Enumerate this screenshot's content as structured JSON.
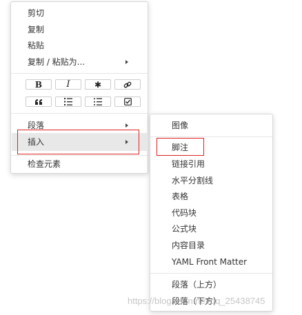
{
  "main_menu": {
    "cut": "剪切",
    "copy": "复制",
    "paste": "粘贴",
    "copy_paste_as": "复制 / 粘贴为...",
    "paragraph": "段落",
    "insert": "插入",
    "inspect": "检查元素",
    "format_buttons": [
      {
        "icon": "bold-icon",
        "glyph": "B"
      },
      {
        "icon": "italic-icon",
        "glyph": "I"
      },
      {
        "icon": "code-icon",
        "glyph": "✱"
      },
      {
        "icon": "link-icon"
      },
      {
        "icon": "quote-icon"
      },
      {
        "icon": "ordered-list-icon"
      },
      {
        "icon": "unordered-list-icon"
      },
      {
        "icon": "task-list-icon"
      }
    ]
  },
  "sub_menu": {
    "image": "图像",
    "footnote": "脚注",
    "link_reference": "链接引用",
    "horizontal_rule": "水平分割线",
    "table": "表格",
    "code_block": "代码块",
    "math_block": "公式块",
    "toc": "内容目录",
    "yaml_front_matter": "YAML Front Matter",
    "paragraph_above": "段落（上方）",
    "paragraph_below": "段落（下方）"
  },
  "watermark": "https://blog.csdn.net/qq_25438745",
  "colors": {
    "highlight_box": "#e02020",
    "hover_bg": "#e8e8e8",
    "separator": "#e6e6e6"
  }
}
